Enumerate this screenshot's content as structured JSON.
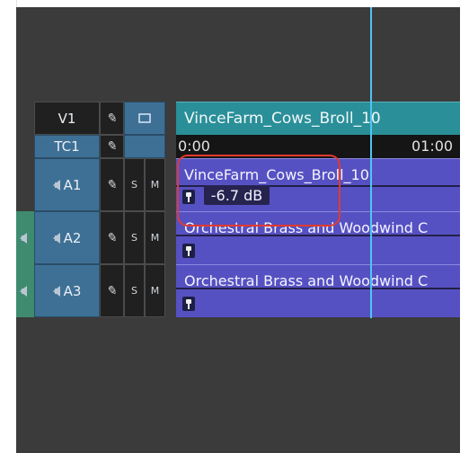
{
  "tracks": {
    "v1": {
      "label": "V1"
    },
    "tc1": {
      "label": "TC1"
    },
    "a1": {
      "label": "A1"
    },
    "a2": {
      "label": "A2"
    },
    "a3": {
      "label": "A3"
    },
    "s_label": "S",
    "m_label": "M"
  },
  "timeline": {
    "video_clip_name": "VinceFarm_Cows_Broll_10",
    "timecode_start": "0:00",
    "timecode_end": "01:00",
    "a1_clip_name": "VinceFarm_Cows_Broll_10",
    "a1_gain": "-6.7 dB",
    "a2_clip_name": "Orchestral Brass and Woodwind C",
    "a3_clip_name": "Orchestral Brass and Woodwind C"
  },
  "colors": {
    "panel_bg": "#3b3b3b",
    "track_header_blue": "#3e7096",
    "video_clip_teal": "#2a8f99",
    "audio_clip_purple": "#5651c2",
    "playhead_cyan": "#4fc6f1",
    "highlight_red": "#e23a2f"
  },
  "icons": [
    "pen-icon",
    "monitor-icon",
    "speaker-icon",
    "marker-icon"
  ]
}
